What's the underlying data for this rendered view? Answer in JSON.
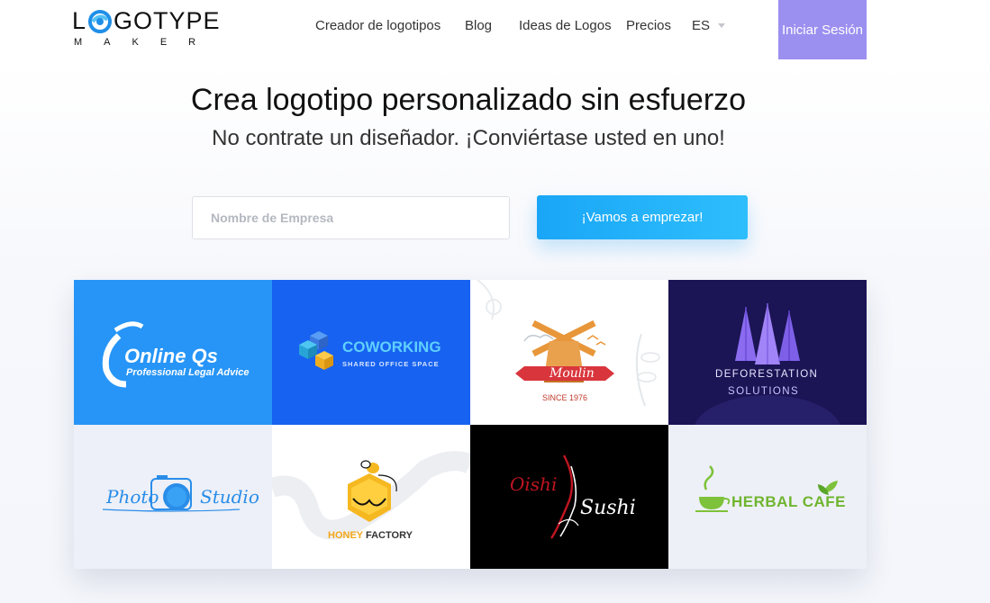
{
  "header": {
    "logo_word_left": "L",
    "logo_word_right": "GOTYPE",
    "logo_sub": "MAKER",
    "nav": [
      "Creador de logotipos",
      "Blog",
      "Ideas de Logos",
      "Precios"
    ],
    "language": "ES",
    "login_label": "Iniciar Sesión"
  },
  "hero": {
    "title": "Crea logotipo personalizado sin esfuerzo",
    "subtitle": "No contrate un diseñador. ¡Conviértase usted en uno!",
    "input_placeholder": "Nombre de Empresa",
    "input_value": "",
    "cta_label": "¡Vamos a emprezar!"
  },
  "logos": [
    {
      "name": "Online Qs",
      "tagline": "Professional Legal Advice"
    },
    {
      "name": "COWORKING",
      "tagline": "SHARED OFFICE SPACE"
    },
    {
      "name": "Moulin",
      "tagline": "SINCE 1976"
    },
    {
      "name": "DEFORESTATION",
      "tagline": "SOLUTIONS"
    },
    {
      "name": "Photo",
      "tagline": "Studio"
    },
    {
      "name": "HONEY",
      "tagline": "FACTORY"
    },
    {
      "name": "Oishi",
      "tagline": "Sushi"
    },
    {
      "name": "HERBAL CAFE",
      "tagline": ""
    }
  ],
  "colors": {
    "accent": "#9b8ff0",
    "cta": "#1aa6f7",
    "brand_blue": "#2695f7"
  }
}
